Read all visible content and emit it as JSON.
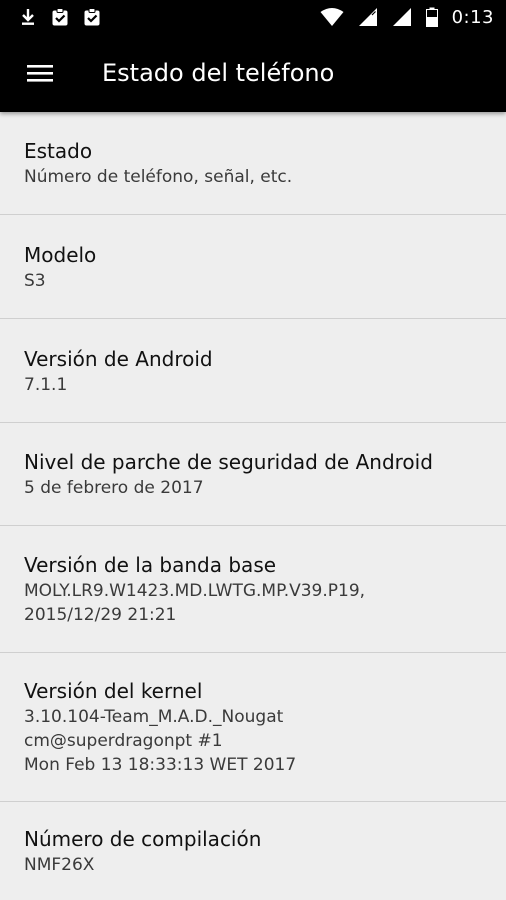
{
  "status_bar": {
    "time": "0:13",
    "left_icons": [
      "download-icon",
      "clipboard-check-icon",
      "clipboard-check-icon"
    ],
    "right_icons": [
      "wifi-icon",
      "signal-icon",
      "signal-icon",
      "battery-icon"
    ]
  },
  "toolbar": {
    "title": "Estado del teléfono",
    "menu_icon": "menu-icon"
  },
  "items": [
    {
      "title": "Estado",
      "summary": "Número de teléfono, señal, etc."
    },
    {
      "title": "Modelo",
      "summary": "S3"
    },
    {
      "title": "Versión de Android",
      "summary": "7.1.1"
    },
    {
      "title": "Nivel de parche de seguridad de Android",
      "summary": "5 de febrero de 2017"
    },
    {
      "title": "Versión de la banda base",
      "summary": "MOLY.LR9.W1423.MD.LWTG.MP.V39.P19,\n2015/12/29 21:21"
    },
    {
      "title": "Versión del kernel",
      "summary": "3.10.104-Team_M.A.D._Nougat\ncm@superdragonpt #1\nMon Feb 13 18:33:13 WET 2017"
    },
    {
      "title": "Número de compilación",
      "summary": "NMF26X"
    }
  ],
  "colors": {
    "status_bar_bg": "#000000",
    "toolbar_bg": "#000000",
    "list_bg": "#eeeeee",
    "divider": "#cfcfcf",
    "title_text": "#111111",
    "summary_text": "#3a3a3a"
  }
}
